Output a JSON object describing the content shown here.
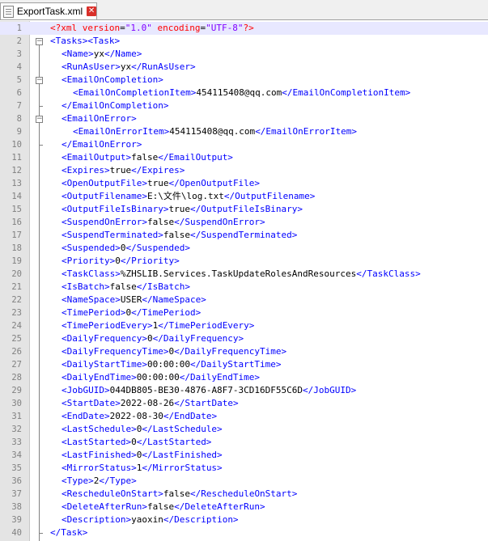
{
  "tab": {
    "filename": "ExportTask.xml",
    "close_glyph": "✕"
  },
  "editor": {
    "xml_decl": {
      "open": "<?xml ",
      "a1": "version",
      "v1": "\"1.0\"",
      "a2": "encoding",
      "v2": "\"UTF-8\"",
      "close": "?>"
    },
    "lines": [
      {
        "n": "1",
        "indent": 0,
        "kind": "decl"
      },
      {
        "n": "2",
        "indent": 0,
        "kind": "open2",
        "t1": "<Tasks>",
        "t2": "<Task>"
      },
      {
        "n": "3",
        "indent": 1,
        "kind": "el",
        "open": "<Name>",
        "text": "yx",
        "close": "</Name>"
      },
      {
        "n": "4",
        "indent": 1,
        "kind": "el",
        "open": "<RunAsUser>",
        "text": "yx",
        "close": "</RunAsUser>"
      },
      {
        "n": "5",
        "indent": 1,
        "kind": "tag",
        "tag": "<EmailOnCompletion>"
      },
      {
        "n": "6",
        "indent": 2,
        "kind": "el",
        "open": "<EmailOnCompletionItem>",
        "text": "454115408@qq.com",
        "close": "</EmailOnCompletionItem>"
      },
      {
        "n": "7",
        "indent": 1,
        "kind": "tag",
        "tag": "</EmailOnCompletion>"
      },
      {
        "n": "8",
        "indent": 1,
        "kind": "tag",
        "tag": "<EmailOnError>"
      },
      {
        "n": "9",
        "indent": 2,
        "kind": "el",
        "open": "<EmailOnErrorItem>",
        "text": "454115408@qq.com",
        "close": "</EmailOnErrorItem>"
      },
      {
        "n": "10",
        "indent": 1,
        "kind": "tag",
        "tag": "</EmailOnError>"
      },
      {
        "n": "11",
        "indent": 1,
        "kind": "el",
        "open": "<EmailOutput>",
        "text": "false",
        "close": "</EmailOutput>"
      },
      {
        "n": "12",
        "indent": 1,
        "kind": "el",
        "open": "<Expires>",
        "text": "true",
        "close": "</Expires>"
      },
      {
        "n": "13",
        "indent": 1,
        "kind": "el",
        "open": "<OpenOutputFile>",
        "text": "true",
        "close": "</OpenOutputFile>"
      },
      {
        "n": "14",
        "indent": 1,
        "kind": "el",
        "open": "<OutputFilename>",
        "text": "E:\\文件\\log.txt",
        "close": "</OutputFilename>"
      },
      {
        "n": "15",
        "indent": 1,
        "kind": "el",
        "open": "<OutputFileIsBinary>",
        "text": "true",
        "close": "</OutputFileIsBinary>"
      },
      {
        "n": "16",
        "indent": 1,
        "kind": "el",
        "open": "<SuspendOnError>",
        "text": "false",
        "close": "</SuspendOnError>"
      },
      {
        "n": "17",
        "indent": 1,
        "kind": "el",
        "open": "<SuspendTerminated>",
        "text": "false",
        "close": "</SuspendTerminated>"
      },
      {
        "n": "18",
        "indent": 1,
        "kind": "el",
        "open": "<Suspended>",
        "text": "0",
        "close": "</Suspended>"
      },
      {
        "n": "19",
        "indent": 1,
        "kind": "el",
        "open": "<Priority>",
        "text": "0",
        "close": "</Priority>"
      },
      {
        "n": "20",
        "indent": 1,
        "kind": "el",
        "open": "<TaskClass>",
        "text": "%ZHSLIB.Services.TaskUpdateRolesAndResources",
        "close": "</TaskClass>"
      },
      {
        "n": "21",
        "indent": 1,
        "kind": "el",
        "open": "<IsBatch>",
        "text": "false",
        "close": "</IsBatch>"
      },
      {
        "n": "22",
        "indent": 1,
        "kind": "el",
        "open": "<NameSpace>",
        "text": "USER",
        "close": "</NameSpace>"
      },
      {
        "n": "23",
        "indent": 1,
        "kind": "el",
        "open": "<TimePeriod>",
        "text": "0",
        "close": "</TimePeriod>"
      },
      {
        "n": "24",
        "indent": 1,
        "kind": "el",
        "open": "<TimePeriodEvery>",
        "text": "1",
        "close": "</TimePeriodEvery>"
      },
      {
        "n": "25",
        "indent": 1,
        "kind": "el",
        "open": "<DailyFrequency>",
        "text": "0",
        "close": "</DailyFrequency>"
      },
      {
        "n": "26",
        "indent": 1,
        "kind": "el",
        "open": "<DailyFrequencyTime>",
        "text": "0",
        "close": "</DailyFrequencyTime>"
      },
      {
        "n": "27",
        "indent": 1,
        "kind": "el",
        "open": "<DailyStartTime>",
        "text": "00:00:00",
        "close": "</DailyStartTime>"
      },
      {
        "n": "28",
        "indent": 1,
        "kind": "el",
        "open": "<DailyEndTime>",
        "text": "00:00:00",
        "close": "</DailyEndTime>"
      },
      {
        "n": "29",
        "indent": 1,
        "kind": "el",
        "open": "<JobGUID>",
        "text": "044DB805-BE30-4876-A8F7-3CD16DF55C6D",
        "close": "</JobGUID>"
      },
      {
        "n": "30",
        "indent": 1,
        "kind": "el",
        "open": "<StartDate>",
        "text": "2022-08-26",
        "close": "</StartDate>"
      },
      {
        "n": "31",
        "indent": 1,
        "kind": "el",
        "open": "<EndDate>",
        "text": "2022-08-30",
        "close": "</EndDate>"
      },
      {
        "n": "32",
        "indent": 1,
        "kind": "el",
        "open": "<LastSchedule>",
        "text": "0",
        "close": "</LastSchedule>"
      },
      {
        "n": "33",
        "indent": 1,
        "kind": "el",
        "open": "<LastStarted>",
        "text": "0",
        "close": "</LastStarted>"
      },
      {
        "n": "34",
        "indent": 1,
        "kind": "el",
        "open": "<LastFinished>",
        "text": "0",
        "close": "</LastFinished>"
      },
      {
        "n": "35",
        "indent": 1,
        "kind": "el",
        "open": "<MirrorStatus>",
        "text": "1",
        "close": "</MirrorStatus>"
      },
      {
        "n": "36",
        "indent": 1,
        "kind": "el",
        "open": "<Type>",
        "text": "2",
        "close": "</Type>"
      },
      {
        "n": "37",
        "indent": 1,
        "kind": "el",
        "open": "<RescheduleOnStart>",
        "text": "false",
        "close": "</RescheduleOnStart>"
      },
      {
        "n": "38",
        "indent": 1,
        "kind": "el",
        "open": "<DeleteAfterRun>",
        "text": "false",
        "close": "</DeleteAfterRun>"
      },
      {
        "n": "39",
        "indent": 1,
        "kind": "el",
        "open": "<Description>",
        "text": "yaoxin",
        "close": "</Description>"
      },
      {
        "n": "40",
        "indent": 0,
        "kind": "tag",
        "tag": "</Task>"
      }
    ]
  },
  "colors": {
    "tag": "#0000ff",
    "text": "#000000",
    "decl": "#ff0000",
    "attr_value": "#8000ff",
    "current_line": "#e8e8ff"
  }
}
